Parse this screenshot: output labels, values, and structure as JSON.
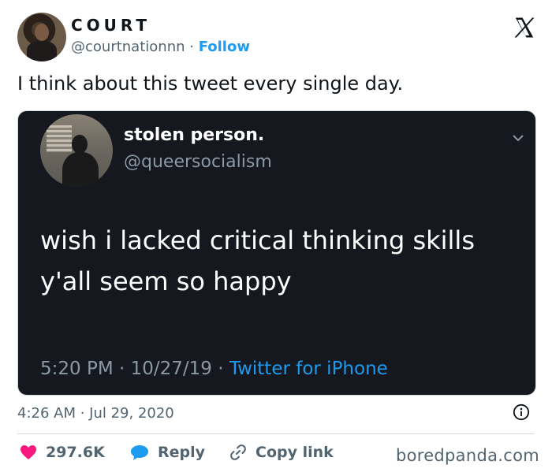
{
  "user": {
    "display_name": "COURT",
    "handle": "@courtnationnn",
    "separator": " · ",
    "follow_label": "Follow"
  },
  "tweet": {
    "text": "I think about this tweet every single day.",
    "timestamp": "4:26 AM · Jul 29, 2020"
  },
  "embedded": {
    "display_name": "stolen person.",
    "handle": "@queersocialism",
    "line1": "wish i lacked critical thinking skills",
    "line2": "y'all seem so happy",
    "meta": "5:20 PM · 10/27/19 · ",
    "source": "Twitter for iPhone"
  },
  "actions": {
    "likes": "297.6K",
    "reply_label": "Reply",
    "copy_label": "Copy link"
  },
  "watermark": "boredpanda.com",
  "colors": {
    "accent": "#1d9bf0",
    "like": "#f91880",
    "text": "#0f1419",
    "muted": "#536471",
    "dark_card": "#15181e"
  },
  "icons": [
    "x-logo-icon",
    "chevron-down-icon",
    "info-icon",
    "heart-icon",
    "reply-bubble-icon",
    "link-icon"
  ]
}
